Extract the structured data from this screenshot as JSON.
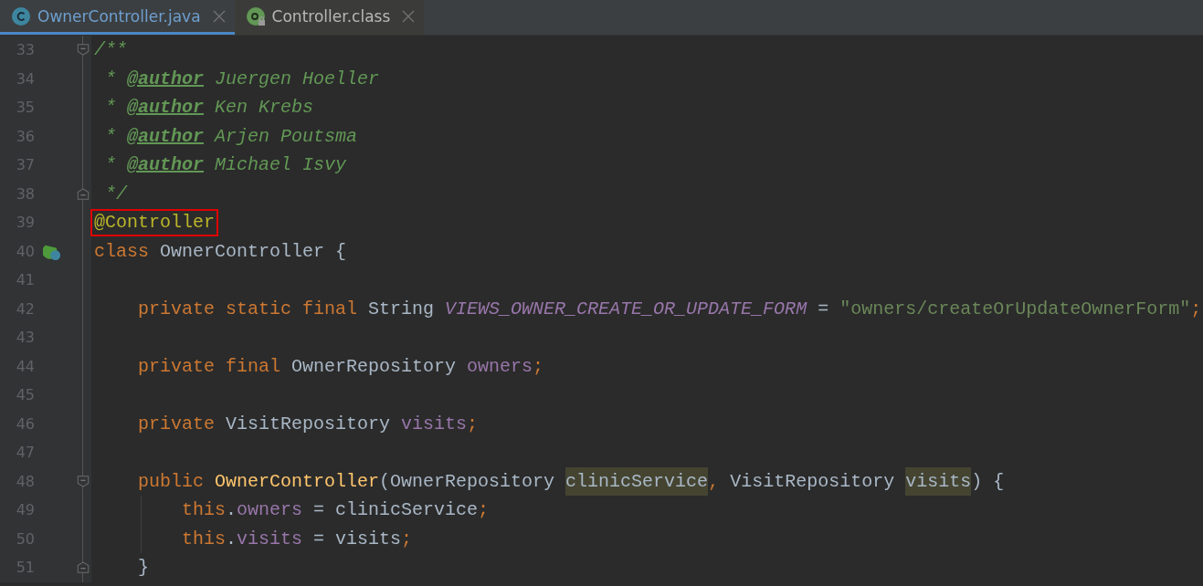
{
  "tabs": [
    {
      "label": "OwnerController.java",
      "kind": "class",
      "locked": false,
      "selected": true
    },
    {
      "label": "Controller.class",
      "kind": "annotation",
      "locked": true,
      "selected": false
    }
  ],
  "lines": [
    {
      "number": "33",
      "kind": "top",
      "fold_start": true,
      "tokens": [
        {
          "text": "/**",
          "kind": "comment"
        }
      ]
    },
    {
      "number": "34",
      "kind": "top",
      "tokens": [
        {
          "text": " * ",
          "kind": "comment"
        },
        {
          "text": "@author",
          "kind": "doctag"
        },
        {
          "text": " Juergen Hoeller",
          "kind": "comment"
        }
      ]
    },
    {
      "number": "35",
      "kind": "top",
      "tokens": [
        {
          "text": " * ",
          "kind": "comment"
        },
        {
          "text": "@author",
          "kind": "doctag"
        },
        {
          "text": " Ken Krebs",
          "kind": "comment"
        }
      ]
    },
    {
      "number": "36",
      "kind": "top",
      "tokens": [
        {
          "text": " * ",
          "kind": "comment"
        },
        {
          "text": "@author",
          "kind": "doctag"
        },
        {
          "text": " Arjen Poutsma",
          "kind": "comment"
        }
      ]
    },
    {
      "number": "37",
      "kind": "top",
      "tokens": [
        {
          "text": " * ",
          "kind": "comment"
        },
        {
          "text": "@author",
          "kind": "doctag"
        },
        {
          "text": " Michael Isvy",
          "kind": "comment"
        }
      ]
    },
    {
      "number": "38",
      "kind": "top",
      "fold_end": true,
      "tokens": [
        {
          "text": " */",
          "kind": "comment"
        }
      ]
    },
    {
      "number": "39",
      "kind": "top",
      "tokens": [
        {
          "text": "@Controller",
          "kind": "marked-annotation"
        }
      ]
    },
    {
      "number": "40",
      "kind": "top",
      "implemented": true,
      "tokens": [
        {
          "text": "class",
          "kind": "keyword"
        },
        {
          "text": " OwnerController {",
          "kind": "plain"
        }
      ]
    },
    {
      "number": "41",
      "kind": "top"
    },
    {
      "number": "42",
      "kind": "member",
      "tokens": [
        {
          "text": "private static final",
          "kind": "keyword"
        },
        {
          "text": " String ",
          "kind": "plain"
        },
        {
          "text": "VIEWS_OWNER_CREATE_OR_UPDATE_FORM",
          "kind": "constant"
        },
        {
          "text": " = ",
          "kind": "plain"
        },
        {
          "text": "\"owners/createOrUpdateOwnerForm\"",
          "kind": "string"
        },
        {
          "text": ";",
          "kind": "keyword"
        }
      ]
    },
    {
      "number": "43",
      "kind": "top"
    },
    {
      "number": "44",
      "kind": "member",
      "tokens": [
        {
          "text": "private final",
          "kind": "keyword"
        },
        {
          "text": " OwnerRepository ",
          "kind": "plain"
        },
        {
          "text": "owners",
          "kind": "field"
        },
        {
          "text": ";",
          "kind": "keyword"
        }
      ]
    },
    {
      "number": "45",
      "kind": "top"
    },
    {
      "number": "46",
      "kind": "member",
      "tokens": [
        {
          "text": "private",
          "kind": "keyword"
        },
        {
          "text": " VisitRepository ",
          "kind": "plain"
        },
        {
          "text": "visits",
          "kind": "field"
        },
        {
          "text": ";",
          "kind": "keyword"
        }
      ]
    },
    {
      "number": "47",
      "kind": "top"
    },
    {
      "number": "48",
      "kind": "member",
      "fold_start": true,
      "tokens": [
        {
          "text": "public ",
          "kind": "keyword"
        },
        {
          "text": "OwnerController",
          "kind": "method"
        },
        {
          "text": "(OwnerRepository ",
          "kind": "plain"
        },
        {
          "text": "clinicService",
          "kind": "highlighted-param"
        },
        {
          "text": ",",
          "kind": "keyword"
        },
        {
          "text": " VisitRepository ",
          "kind": "plain"
        },
        {
          "text": "visits",
          "kind": "highlighted-param"
        },
        {
          "text": ") {",
          "kind": "plain"
        }
      ]
    },
    {
      "number": "49",
      "kind": "statement",
      "indent_guide": true,
      "tokens": [
        {
          "text": "this",
          "kind": "keyword"
        },
        {
          "text": ".",
          "kind": "plain"
        },
        {
          "text": "owners",
          "kind": "field"
        },
        {
          "text": " = clinicService",
          "kind": "plain"
        },
        {
          "text": ";",
          "kind": "keyword"
        }
      ]
    },
    {
      "number": "50",
      "kind": "statement",
      "indent_guide": true,
      "tokens": [
        {
          "text": "this",
          "kind": "keyword"
        },
        {
          "text": ".",
          "kind": "plain"
        },
        {
          "text": "visits",
          "kind": "field"
        },
        {
          "text": " = visits",
          "kind": "plain"
        },
        {
          "text": ";",
          "kind": "keyword"
        }
      ]
    },
    {
      "number": "51",
      "kind": "member",
      "fold_end": true,
      "tokens": [
        {
          "text": "}",
          "kind": "plain"
        }
      ]
    }
  ]
}
